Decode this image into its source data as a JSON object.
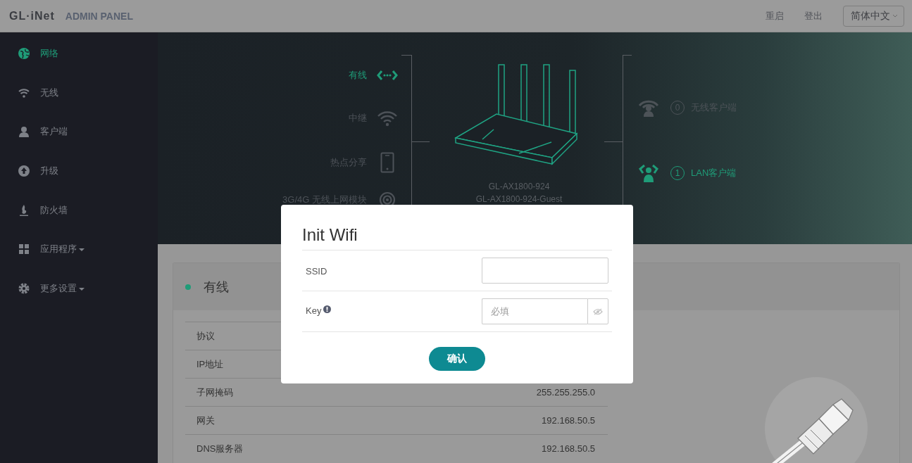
{
  "header": {
    "logo": "GL·iNet",
    "title": "ADMIN PANEL",
    "links": [
      "重启",
      "登出"
    ],
    "language": "简体中文"
  },
  "sidebar": {
    "items": [
      {
        "label": "网络",
        "selected": true,
        "dropdown": false
      },
      {
        "label": "无线",
        "selected": false,
        "dropdown": false
      },
      {
        "label": "客户端",
        "selected": false,
        "dropdown": false
      },
      {
        "label": "升级",
        "selected": false,
        "dropdown": false
      },
      {
        "label": "防火墙",
        "selected": false,
        "dropdown": false
      },
      {
        "label": "应用程序",
        "selected": false,
        "dropdown": true
      },
      {
        "label": "更多设置",
        "selected": false,
        "dropdown": true
      }
    ]
  },
  "hero": {
    "uplinks": [
      {
        "label": "有线",
        "active": true
      },
      {
        "label": "中继",
        "active": false
      },
      {
        "label": "热点分享",
        "active": false
      },
      {
        "label": "3G/4G 无线上网模块",
        "active": false
      }
    ],
    "ssids": [
      "GL-AX1800-924",
      "GL-AX1800-924-Guest"
    ],
    "clients": [
      {
        "count": "0",
        "label": "无线客户端",
        "active": false
      },
      {
        "count": "1",
        "label": "LAN客户端",
        "active": true
      }
    ]
  },
  "card": {
    "title": "有线",
    "rows": [
      {
        "label": "协议"
      },
      {
        "label": "IP地址"
      },
      {
        "label": "子网掩码",
        "value": "255.255.255.0"
      },
      {
        "label": "网关",
        "value": "192.168.50.5"
      },
      {
        "label": "DNS服务器",
        "value": "192.168.50.5"
      }
    ]
  },
  "modal": {
    "title": "Init Wifi",
    "fields": [
      {
        "label": "SSID",
        "kind": "text",
        "info": false
      },
      {
        "label": "Key",
        "kind": "password",
        "info": true,
        "placeholder": "必填"
      }
    ],
    "button": "确认"
  }
}
